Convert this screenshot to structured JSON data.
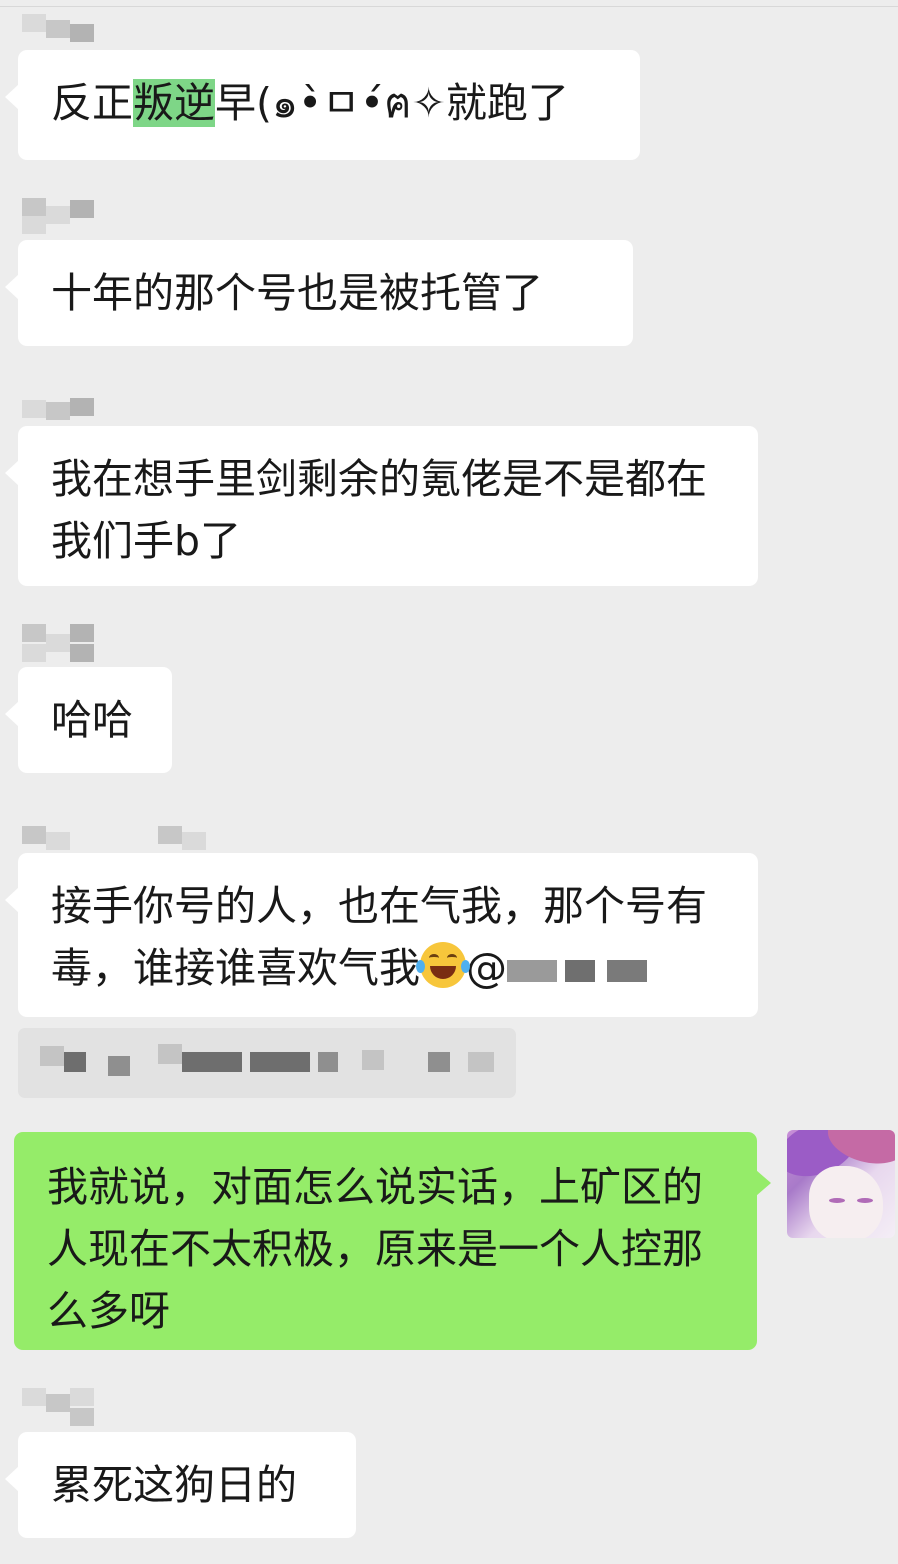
{
  "messages": [
    {
      "side": "left",
      "text_before": "反正",
      "highlight": "叛逆",
      "text_after": "早(๑•̀ㅁ•́ฅ✧就跑了"
    },
    {
      "side": "left",
      "text": "十年的那个号也是被托管了"
    },
    {
      "side": "left",
      "text": "我在想手里剑剩余的氪佬是不是都在我们手b了"
    },
    {
      "side": "left",
      "text": "哈哈"
    },
    {
      "side": "left",
      "text": "接手你号的人，也在气我，那个号有毒，谁接谁喜欢气我",
      "emoji": "face-with-tears-of-joy",
      "mention_prefix": "@"
    },
    {
      "side": "right",
      "text": "我就说，对面怎么说实话，上矿区的人现在不太积极，原来是一个人控那么多呀"
    },
    {
      "side": "left",
      "text": "累死这狗日的"
    }
  ],
  "colors": {
    "background": "#ededed",
    "incoming_bubble": "#ffffff",
    "outgoing_bubble": "#95ec69",
    "highlight": "#7ed687"
  }
}
